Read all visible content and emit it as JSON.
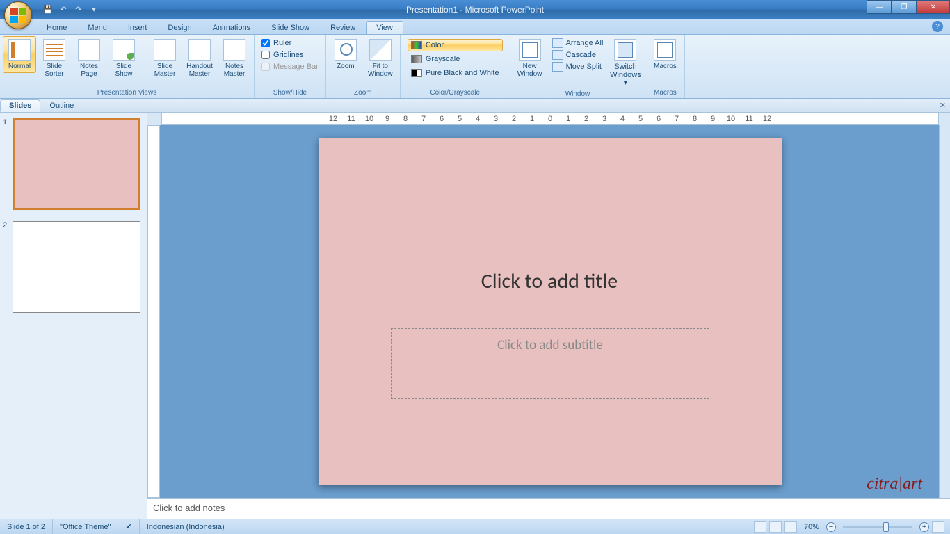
{
  "title": "Presentation1 - Microsoft PowerPoint",
  "tabs": [
    "Home",
    "Menu",
    "Insert",
    "Design",
    "Animations",
    "Slide Show",
    "Review",
    "View"
  ],
  "active_tab": "View",
  "ribbon": {
    "groups": {
      "views": {
        "label": "Presentation Views",
        "items": [
          "Normal",
          "Slide Sorter",
          "Notes Page",
          "Slide Show",
          "Slide Master",
          "Handout Master",
          "Notes Master"
        ]
      },
      "showhide": {
        "label": "Show/Hide",
        "ruler": "Ruler",
        "gridlines": "Gridlines",
        "messagebar": "Message Bar"
      },
      "zoom": {
        "label": "Zoom",
        "zoom": "Zoom",
        "fit": "Fit to Window"
      },
      "color": {
        "label": "Color/Grayscale",
        "color": "Color",
        "gray": "Grayscale",
        "bw": "Pure Black and White"
      },
      "window": {
        "label": "Window",
        "new": "New Window",
        "arrange": "Arrange All",
        "cascade": "Cascade",
        "split": "Move Split",
        "switch": "Switch Windows"
      },
      "macros": {
        "label": "Macros",
        "btn": "Macros"
      }
    }
  },
  "panel_tabs": {
    "slides": "Slides",
    "outline": "Outline"
  },
  "slide": {
    "title_ph": "Click to add title",
    "subtitle_ph": "Click to add subtitle"
  },
  "notes_ph": "Click to add notes",
  "status": {
    "slide": "Slide 1 of 2",
    "theme": "\"Office Theme\"",
    "lang": "Indonesian (Indonesia)",
    "zoom": "70%"
  },
  "watermark": "citra|art",
  "thumbs": [
    "1",
    "2"
  ]
}
